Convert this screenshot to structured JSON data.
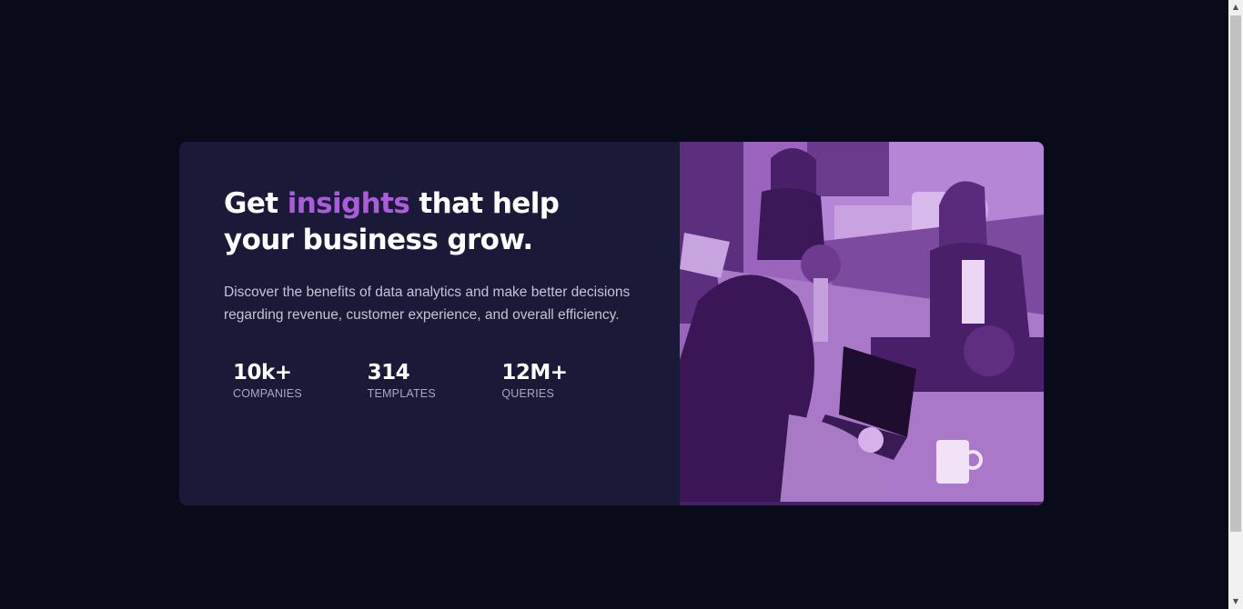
{
  "headline": {
    "part1": "Get ",
    "accent": "insights",
    "part2": " that help your business grow."
  },
  "description": "Discover the benefits of data analytics and make better decisions regarding revenue, customer experience, and overall efficiency.",
  "stats": [
    {
      "value": "10k+",
      "label": "COMPANIES"
    },
    {
      "value": "314",
      "label": "TEMPLATES"
    },
    {
      "value": "12M+",
      "label": "QUERIES"
    }
  ],
  "image": {
    "icon": "team-at-desk-photo"
  },
  "scrollbar": {
    "up_icon": "▲",
    "down_icon": "▼"
  },
  "colors": {
    "background": "#090b1a",
    "card": "#1b1938",
    "accent": "#ab5cdb",
    "image_overlay": "#9a64bd"
  }
}
